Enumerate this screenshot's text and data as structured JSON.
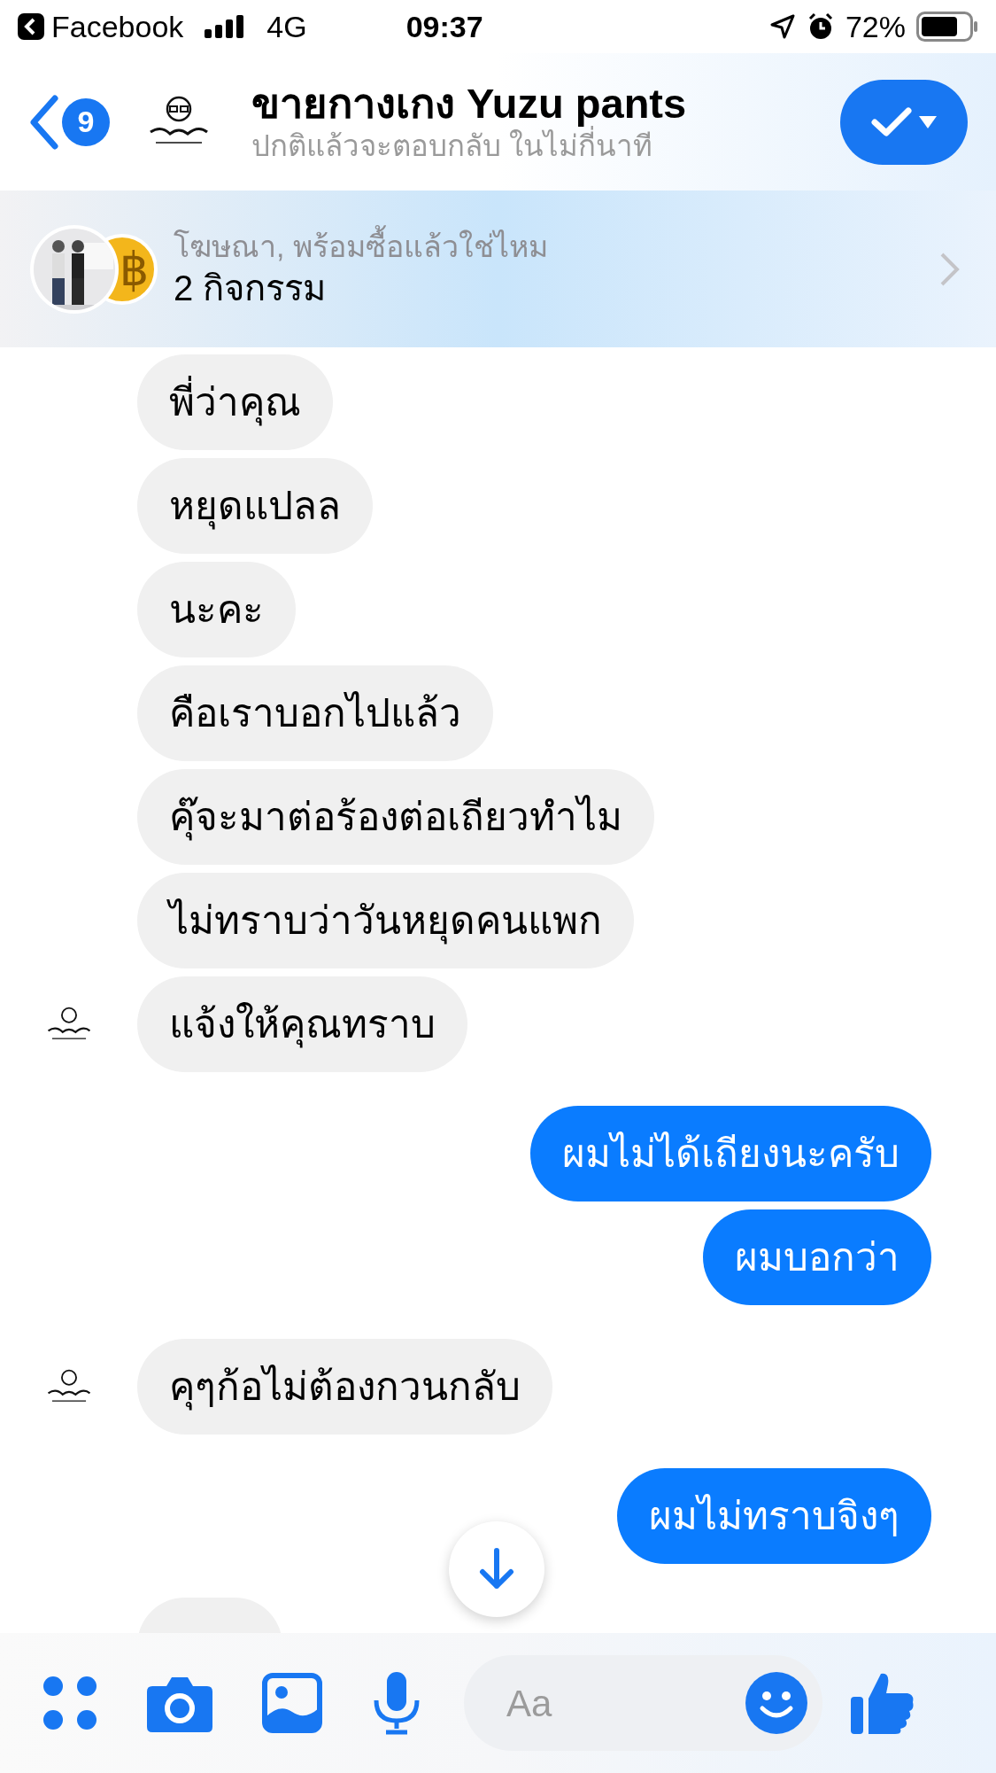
{
  "status_bar": {
    "back_app": "Facebook",
    "network": "4G",
    "time": "09:37",
    "battery": "72%"
  },
  "header": {
    "unread_count": "9",
    "title": "ขายกางเกง Yuzu pants",
    "subtitle": "ปกติแล้วจะตอบกลับ ในไม่กี่นาที"
  },
  "ad_banner": {
    "coin_symbol": "฿",
    "caption": "โฆษณา, พร้อมซื้อแล้วใช่ไหม",
    "activities": "2 กิจกรรม"
  },
  "groups": [
    {
      "kind": "incoming",
      "messages": [
        "พี่ว่าคุณ",
        "หยุดแปลล",
        "นะคะ",
        "คือเราบอกไปแล้ว",
        "คุ๊จะมาต่อร้องต่อเถียวทำไม",
        "ไม่ทราบว่าวันหยุดคนแพก",
        "แจ้งให้คุณทราบ"
      ]
    },
    {
      "kind": "outgoing",
      "messages": [
        "ผมไม่ได้เถียงนะครับ",
        "ผมบอกว่า"
      ]
    },
    {
      "kind": "incoming",
      "messages": [
        "คุๆก้อไม่ต้องกวนกลับ"
      ]
    },
    {
      "kind": "outgoing",
      "messages": [
        "ผมไม่ทราบจิงๆ"
      ]
    },
    {
      "kind": "hidden_incoming"
    }
  ],
  "composer": {
    "placeholder": "Aa"
  }
}
